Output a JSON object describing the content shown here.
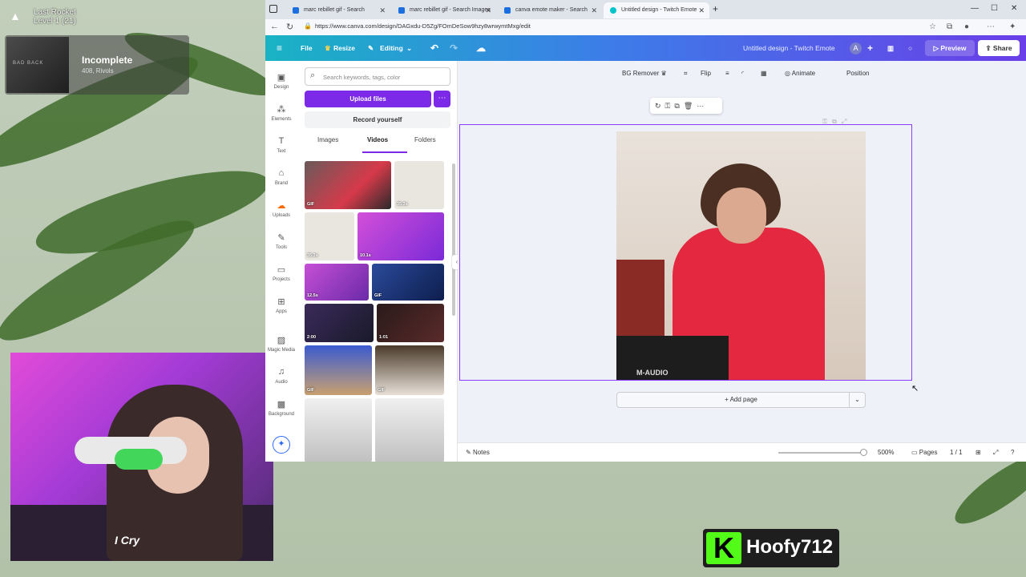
{
  "overlay": {
    "rocket_line1": "Last Rocket",
    "rocket_line2": "Level 1  (21)",
    "song_title": "Incomplete",
    "song_artist": "408, Rivols",
    "album_text": "BAD BACK",
    "cam_shirt": "I Cry",
    "streamer_name": "Hoofy712",
    "kick_letter": "K"
  },
  "browser": {
    "tabs": [
      {
        "label": "marc rebillet gif - Search"
      },
      {
        "label": "marc rebillet gif - Search Images"
      },
      {
        "label": "canva emote maker - Search"
      },
      {
        "label": "Untitled design - Twitch Emote"
      }
    ],
    "url": "https://www.canva.com/design/DAGxdu-D5Zg/FOmDeSow9hzy8wrwymtMxg/edit"
  },
  "canva_header": {
    "file": "File",
    "resize": "Resize",
    "editing": "Editing",
    "design_title": "Untitled design - Twitch Emote",
    "avatar_letter": "A",
    "preview": "Preview",
    "share": "Share"
  },
  "rail": {
    "items": [
      {
        "label": "Design",
        "icon": "design-icon"
      },
      {
        "label": "Elements",
        "icon": "elements-icon"
      },
      {
        "label": "Text",
        "icon": "text-icon"
      },
      {
        "label": "Brand",
        "icon": "brand-icon"
      },
      {
        "label": "Uploads",
        "icon": "uploads-icon"
      },
      {
        "label": "Tools",
        "icon": "tools-icon"
      },
      {
        "label": "Projects",
        "icon": "projects-icon"
      },
      {
        "label": "Apps",
        "icon": "apps-icon"
      },
      {
        "label": "Magic Media",
        "icon": "magic-media-icon"
      },
      {
        "label": "Audio",
        "icon": "audio-icon"
      },
      {
        "label": "Background",
        "icon": "background-icon"
      }
    ]
  },
  "panel": {
    "search_placeholder": "Search keywords, tags, color",
    "upload": "Upload files",
    "record": "Record yourself",
    "tabs": [
      "Images",
      "Videos",
      "Folders"
    ],
    "thumbs": [
      {
        "label": "GIF"
      },
      {
        "label": "35.3s"
      },
      {
        "label": "35.3s"
      },
      {
        "label": "10.1s"
      },
      {
        "label": "12.5s"
      },
      {
        "label": "GIF"
      },
      {
        "label": "2:00"
      },
      {
        "label": "1:01"
      },
      {
        "label": "GIF"
      },
      {
        "label": "GIF"
      },
      {
        "label": ""
      },
      {
        "label": ""
      }
    ]
  },
  "toolbar": {
    "bg_remover": "BG Remover",
    "flip": "Flip",
    "animate": "Animate",
    "position": "Position"
  },
  "canvas": {
    "page_label": "M-AUDIO",
    "add_page": "+ Add page"
  },
  "footer": {
    "notes": "Notes",
    "zoom": "500%",
    "pages": "Pages",
    "page_count": "1 / 1"
  },
  "colors": {
    "canva_purple": "#7d2ae8",
    "selection": "#8b3dff",
    "kick_green": "#53fc18"
  }
}
